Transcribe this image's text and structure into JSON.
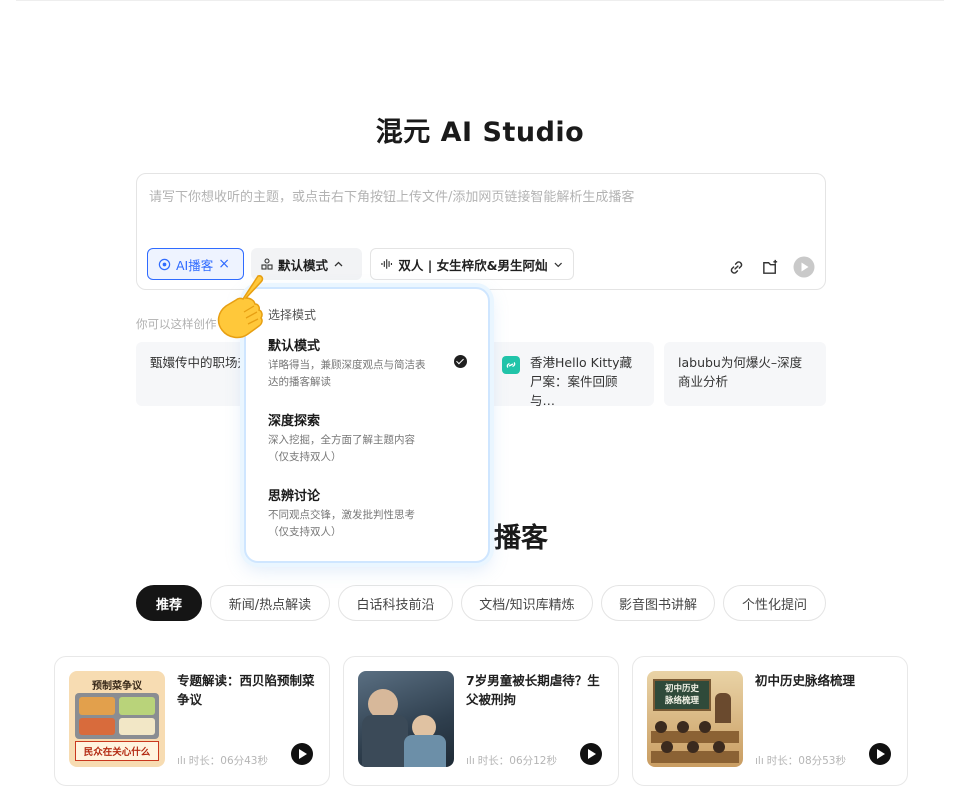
{
  "app_title": "混元 AI Studio",
  "input": {
    "placeholder": "请写下你想收听的主题，或点击右下角按钮上传文件/添加网页链接智能解析生成播客",
    "chip_ai": "AI播客",
    "chip_ai_close": "×",
    "chip_mode": "默认模式",
    "chip_voice": "双人 | 女生梓欣&男生阿灿"
  },
  "hint": "你可以这样创作",
  "ideas": [
    {
      "text": "甄嬛传中的职场升级分析"
    },
    {
      "text": "香港Hello Kitty藏尸案：案件回顾与…"
    },
    {
      "text": "labubu为何爆火–深度商业分析"
    }
  ],
  "dropdown": {
    "heading": "选择模式",
    "items": [
      {
        "title": "默认模式",
        "desc": "详略得当，兼顾深度观点与简洁表达的播客解读",
        "selected": true
      },
      {
        "title": "深度探索",
        "desc": "深入挖掘，全方面了解主题内容（仅支持双人）",
        "selected": false
      },
      {
        "title": "思辨讨论",
        "desc": "不同观点交锋，激发批判性思考（仅支持双人）",
        "selected": false
      }
    ]
  },
  "section_title": "播客",
  "tabs": [
    {
      "label": "推荐",
      "active": true
    },
    {
      "label": "新闻/热点解读",
      "active": false
    },
    {
      "label": "白话科技前沿",
      "active": false
    },
    {
      "label": "文档/知识库精炼",
      "active": false
    },
    {
      "label": "影音图书讲解",
      "active": false
    },
    {
      "label": "个性化提问",
      "active": false
    }
  ],
  "podcasts": [
    {
      "title": "专题解读：西贝陷预制菜争议",
      "duration": "时长：06分43秒",
      "thumb_top_text": "预制菜争议",
      "thumb_bottom_text": "民众在关心什么"
    },
    {
      "title": "7岁男童被长期虐待？生父被刑拘",
      "duration": "时长：06分12秒"
    },
    {
      "title": "初中历史脉络梳理",
      "duration": "时长：08分53秒",
      "thumb_board_text_1": "初中历史",
      "thumb_board_text_2": "脉络梳理"
    }
  ],
  "colors": {
    "accent": "#2f6bff",
    "dark": "#151515"
  }
}
